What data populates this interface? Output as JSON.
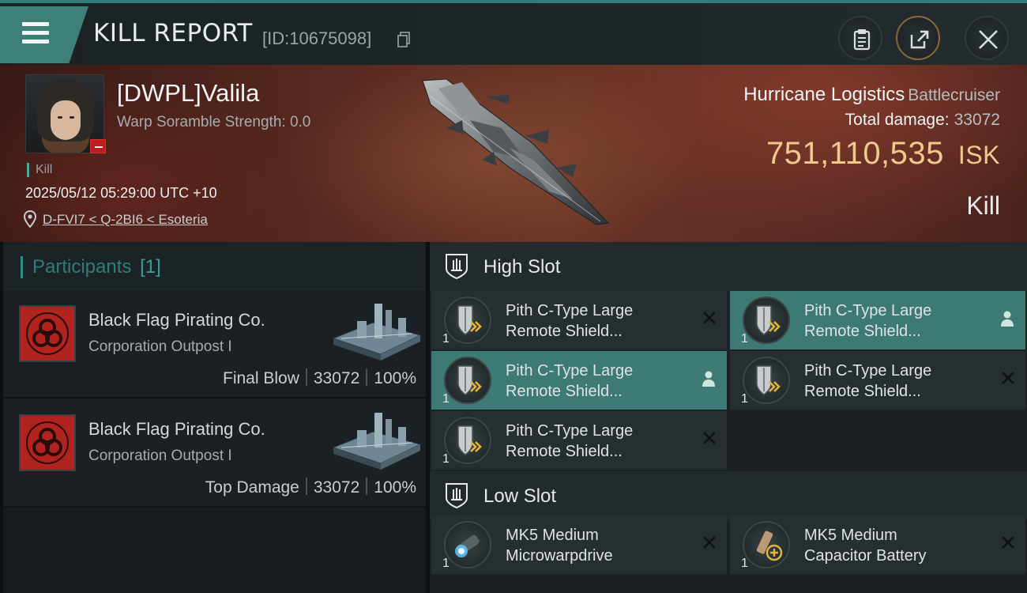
{
  "header": {
    "title": "KILL REPORT",
    "report_id": "[ID:10675098]"
  },
  "victim": {
    "name": "[DWPL]Valila",
    "scramble": "Warp Soramble Strength: 0.0",
    "kill_tag": "Kill",
    "timestamp": "2025/05/12 05:29:00 UTC +10",
    "location": "D-FVI7 < Q-2BI6 < Esoteria",
    "ship_name": "Hurricane Logistics",
    "ship_class": "Battlecruiser",
    "total_damage_label": "Total damage:",
    "total_damage": "33072",
    "isk_value": "751,110,535",
    "isk_unit": "ISK",
    "result": "Kill"
  },
  "participants": {
    "title": "Participants",
    "count": "[1]",
    "rows": [
      {
        "corp": "Black Flag Pirating Co.",
        "type": "Corporation Outpost I",
        "role": "Final Blow",
        "damage": "33072",
        "percent": "100%"
      },
      {
        "corp": "Black Flag Pirating Co.",
        "type": "Corporation Outpost I",
        "role": "Top Damage",
        "damage": "33072",
        "percent": "100%"
      }
    ]
  },
  "fittings": {
    "high_slot_label": "High Slot",
    "low_slot_label": "Low Slot",
    "high": [
      {
        "line1": "Pith C-Type Large",
        "line2": "Remote Shield...",
        "qty": "1"
      },
      {
        "line1": "Pith C-Type Large",
        "line2": "Remote Shield...",
        "qty": "1"
      },
      {
        "line1": "Pith C-Type Large",
        "line2": "Remote Shield...",
        "qty": "1"
      },
      {
        "line1": "Pith C-Type Large",
        "line2": "Remote Shield...",
        "qty": "1"
      },
      {
        "line1": "Pith C-Type Large",
        "line2": "Remote Shield...",
        "qty": "1"
      }
    ],
    "low": [
      {
        "line1": "MK5 Medium",
        "line2": "Microwarpdrive",
        "qty": "1"
      },
      {
        "line1": "MK5 Medium",
        "line2": "Capacitor Battery",
        "qty": "1"
      }
    ]
  },
  "colors": {
    "accent": "#3d7a73",
    "isk": "#f0c98c",
    "emblem": "#b1231f"
  }
}
